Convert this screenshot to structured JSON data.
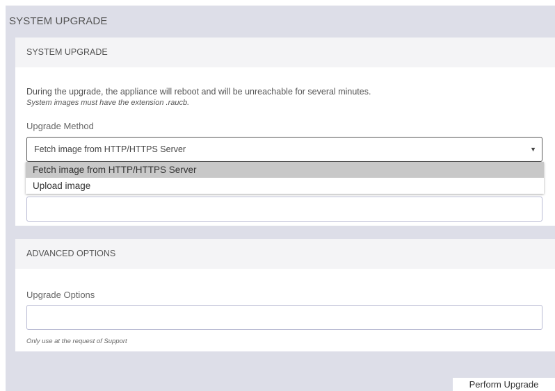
{
  "page": {
    "title": "SYSTEM UPGRADE"
  },
  "upgrade_card": {
    "header": "SYSTEM UPGRADE",
    "description": "During the upgrade, the appliance will reboot and will be unreachable for several minutes.",
    "note": "System images must have the extension .raucb.",
    "method_label": "Upgrade Method",
    "method_selected": "Fetch image from HTTP/HTTPS Server",
    "method_options": [
      "Fetch image from HTTP/HTTPS Server",
      "Upload image"
    ],
    "dropdown_open": true,
    "url_input_value": ""
  },
  "advanced_card": {
    "header": "ADVANCED OPTIONS",
    "options_label": "Upgrade Options",
    "options_value": "",
    "hint": "Only use at the request of Support"
  },
  "actions": {
    "perform_label": "Perform Upgrade"
  },
  "colors": {
    "background": "#dddee8",
    "card": "#ffffff",
    "card_header": "#f4f4f6",
    "input_border": "#b8bad3",
    "dropdown_selected": "#c8c8c8"
  },
  "icons": {
    "select_caret": "caret-down-icon"
  }
}
